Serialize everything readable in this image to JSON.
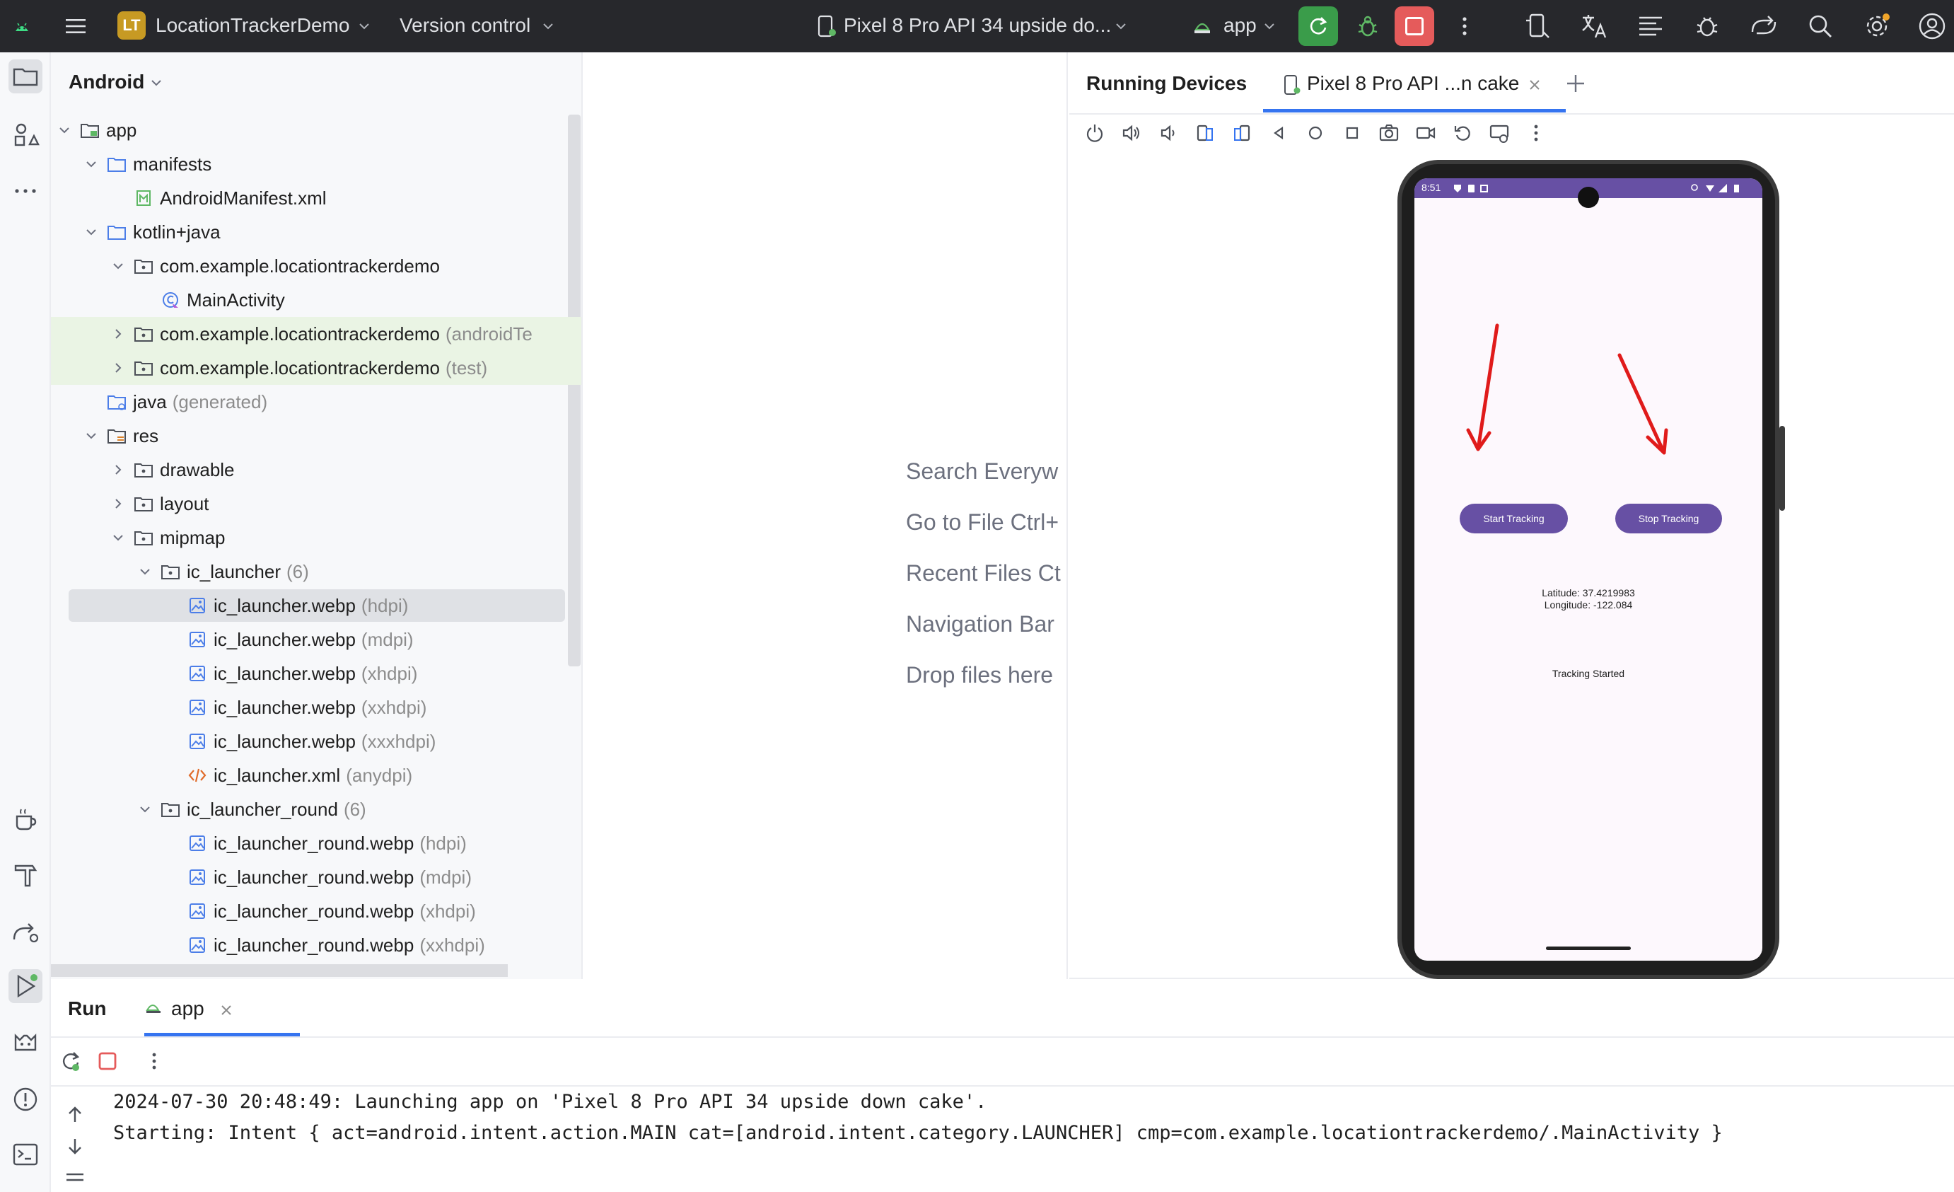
{
  "topbar": {
    "project_badge": "LT",
    "project_name": "LocationTrackerDemo",
    "version_control": "Version control",
    "device_selector": "Pixel 8 Pro API 34 upside do...",
    "run_config": "app"
  },
  "project_panel": {
    "view_mode": "Android",
    "tree": [
      {
        "label": "app",
        "hint": ""
      },
      {
        "label": "manifests",
        "hint": ""
      },
      {
        "label": "AndroidManifest.xml",
        "hint": ""
      },
      {
        "label": "kotlin+java",
        "hint": ""
      },
      {
        "label": "com.example.locationtrackerdemo",
        "hint": ""
      },
      {
        "label": "MainActivity",
        "hint": ""
      },
      {
        "label": "com.example.locationtrackerdemo",
        "hint": "(androidTe"
      },
      {
        "label": "com.example.locationtrackerdemo",
        "hint": "(test)"
      },
      {
        "label": "java",
        "hint": "(generated)"
      },
      {
        "label": "res",
        "hint": ""
      },
      {
        "label": "drawable",
        "hint": ""
      },
      {
        "label": "layout",
        "hint": ""
      },
      {
        "label": "mipmap",
        "hint": ""
      },
      {
        "label": "ic_launcher",
        "hint": "(6)"
      },
      {
        "label": "ic_launcher.webp",
        "hint": "(hdpi)"
      },
      {
        "label": "ic_launcher.webp",
        "hint": "(mdpi)"
      },
      {
        "label": "ic_launcher.webp",
        "hint": "(xhdpi)"
      },
      {
        "label": "ic_launcher.webp",
        "hint": "(xxhdpi)"
      },
      {
        "label": "ic_launcher.webp",
        "hint": "(xxxhdpi)"
      },
      {
        "label": "ic_launcher.xml",
        "hint": "(anydpi)"
      },
      {
        "label": "ic_launcher_round",
        "hint": "(6)"
      },
      {
        "label": "ic_launcher_round.webp",
        "hint": "(hdpi)"
      },
      {
        "label": "ic_launcher_round.webp",
        "hint": "(mdpi)"
      },
      {
        "label": "ic_launcher_round.webp",
        "hint": "(xhdpi)"
      },
      {
        "label": "ic_launcher_round.webp",
        "hint": "(xxhdpi)"
      }
    ]
  },
  "editor_placeholder": {
    "items": [
      "Search Everyw",
      "Go to File Ctrl+",
      "Recent Files Ct",
      "Navigation Bar",
      "Drop files here"
    ]
  },
  "running_devices": {
    "title": "Running Devices",
    "tab_label": "Pixel 8 Pro API ...n cake"
  },
  "phone": {
    "status_time": "8:51",
    "start_button": "Start Tracking",
    "stop_button": "Stop Tracking",
    "latitude": "Latitude: 37.4219983",
    "longitude": "Longitude: -122.084",
    "status_text": "Tracking Started",
    "annotation_color": "#e01b1b",
    "button_color": "#6750a4"
  },
  "run_panel": {
    "title": "Run",
    "tab_label": "app",
    "console": [
      "2024-07-30 20:48:49: Launching app on 'Pixel 8 Pro API 34 upside down cake'.",
      "Starting: Intent { act=android.intent.action.MAIN cat=[android.intent.category.LAUNCHER] cmp=com.example.locationtrackerdemo/.MainActivity }"
    ]
  },
  "colors": {
    "topbar_bg": "#27282c",
    "run_green": "#3a9c4a",
    "stop_red": "#e55b5b",
    "selection": "#dfe1e5",
    "accent_blue": "#3574f0"
  }
}
